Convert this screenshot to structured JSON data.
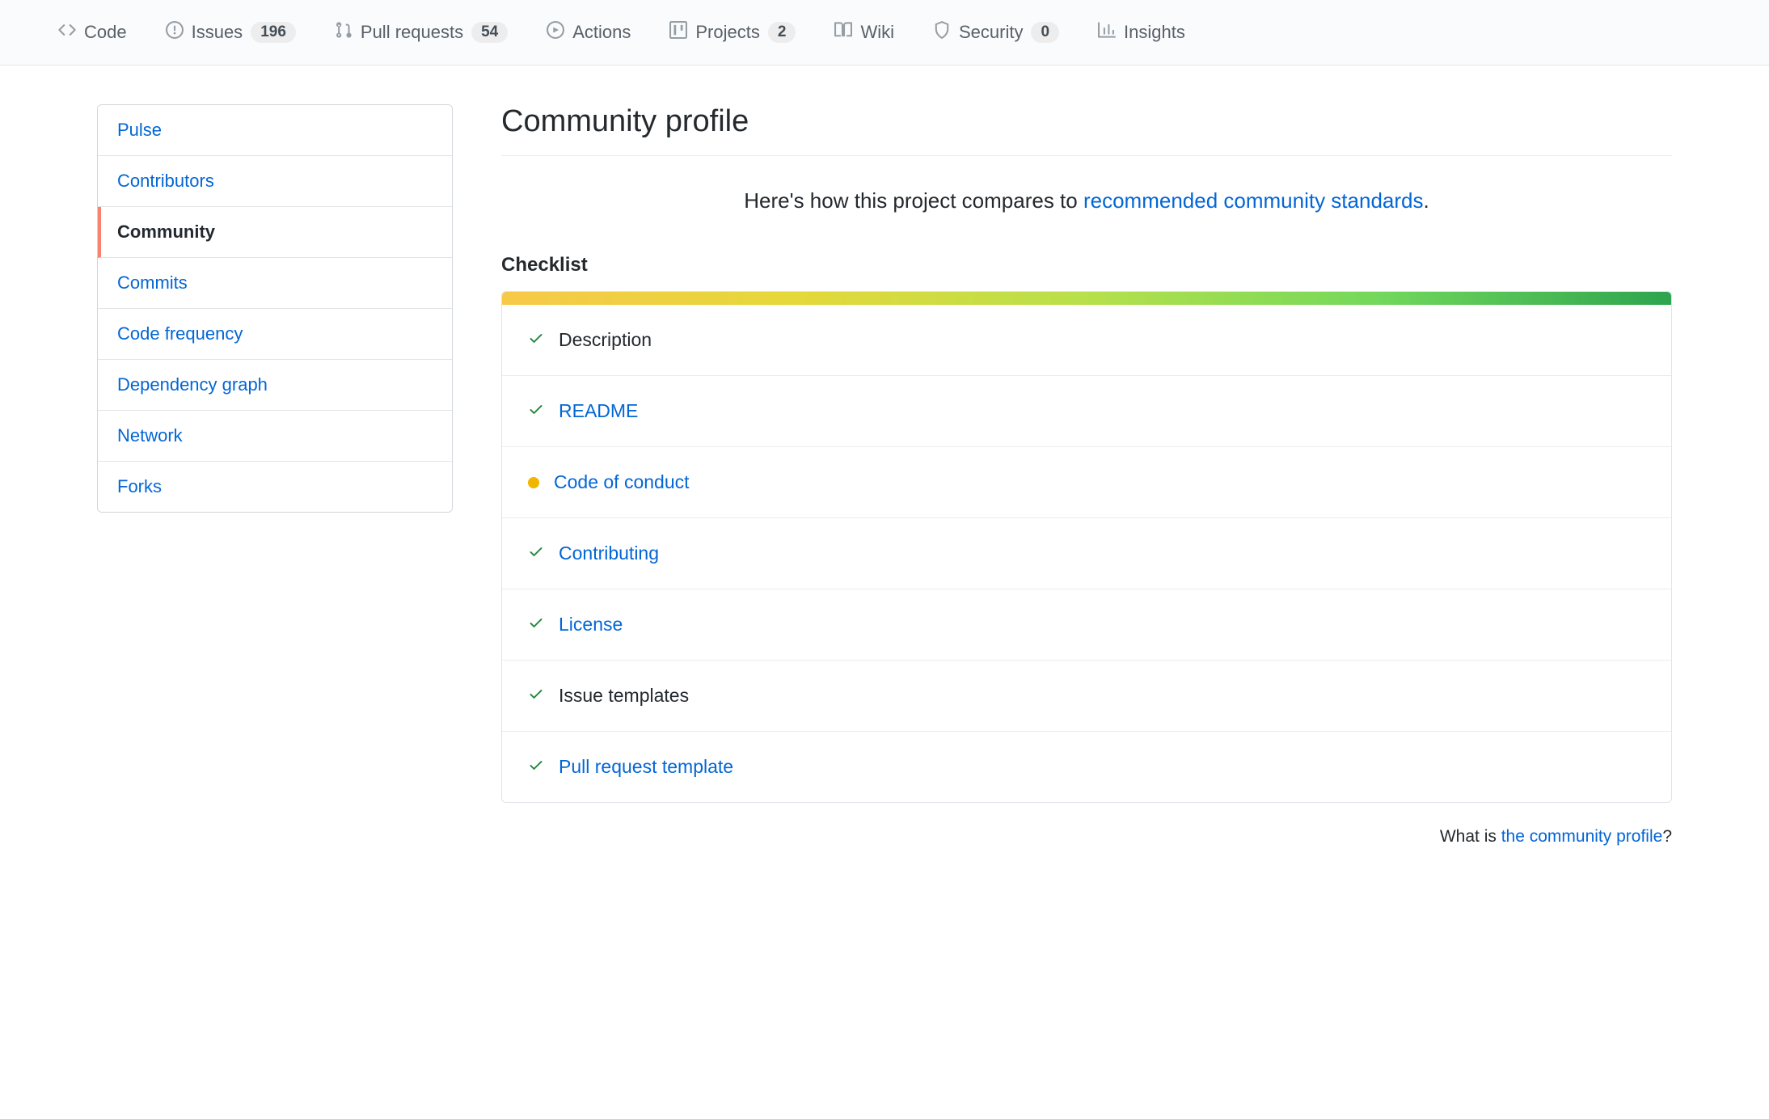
{
  "topnav": {
    "items": [
      {
        "name": "code",
        "label": "Code",
        "count": null
      },
      {
        "name": "issues",
        "label": "Issues",
        "count": "196"
      },
      {
        "name": "pulls",
        "label": "Pull requests",
        "count": "54"
      },
      {
        "name": "actions",
        "label": "Actions",
        "count": null
      },
      {
        "name": "projects",
        "label": "Projects",
        "count": "2"
      },
      {
        "name": "wiki",
        "label": "Wiki",
        "count": null
      },
      {
        "name": "security",
        "label": "Security",
        "count": "0"
      },
      {
        "name": "insights",
        "label": "Insights",
        "count": null
      }
    ]
  },
  "sidebar": {
    "items": [
      {
        "label": "Pulse",
        "active": false
      },
      {
        "label": "Contributors",
        "active": false
      },
      {
        "label": "Community",
        "active": true
      },
      {
        "label": "Commits",
        "active": false
      },
      {
        "label": "Code frequency",
        "active": false
      },
      {
        "label": "Dependency graph",
        "active": false
      },
      {
        "label": "Network",
        "active": false
      },
      {
        "label": "Forks",
        "active": false
      }
    ]
  },
  "page": {
    "title": "Community profile",
    "subtitle_prefix": "Here's how this project compares to ",
    "subtitle_link": "recommended community standards",
    "subtitle_suffix": ".",
    "checklist_heading": "Checklist",
    "footer_prefix": "What is ",
    "footer_link": "the community profile",
    "footer_suffix": "?"
  },
  "checklist": [
    {
      "status": "check",
      "label": "Description",
      "link": false
    },
    {
      "status": "check",
      "label": "README",
      "link": true
    },
    {
      "status": "dot",
      "label": "Code of conduct",
      "link": true
    },
    {
      "status": "check",
      "label": "Contributing",
      "link": true
    },
    {
      "status": "check",
      "label": "License",
      "link": true
    },
    {
      "status": "check",
      "label": "Issue templates",
      "link": false
    },
    {
      "status": "check",
      "label": "Pull request template",
      "link": true
    }
  ]
}
